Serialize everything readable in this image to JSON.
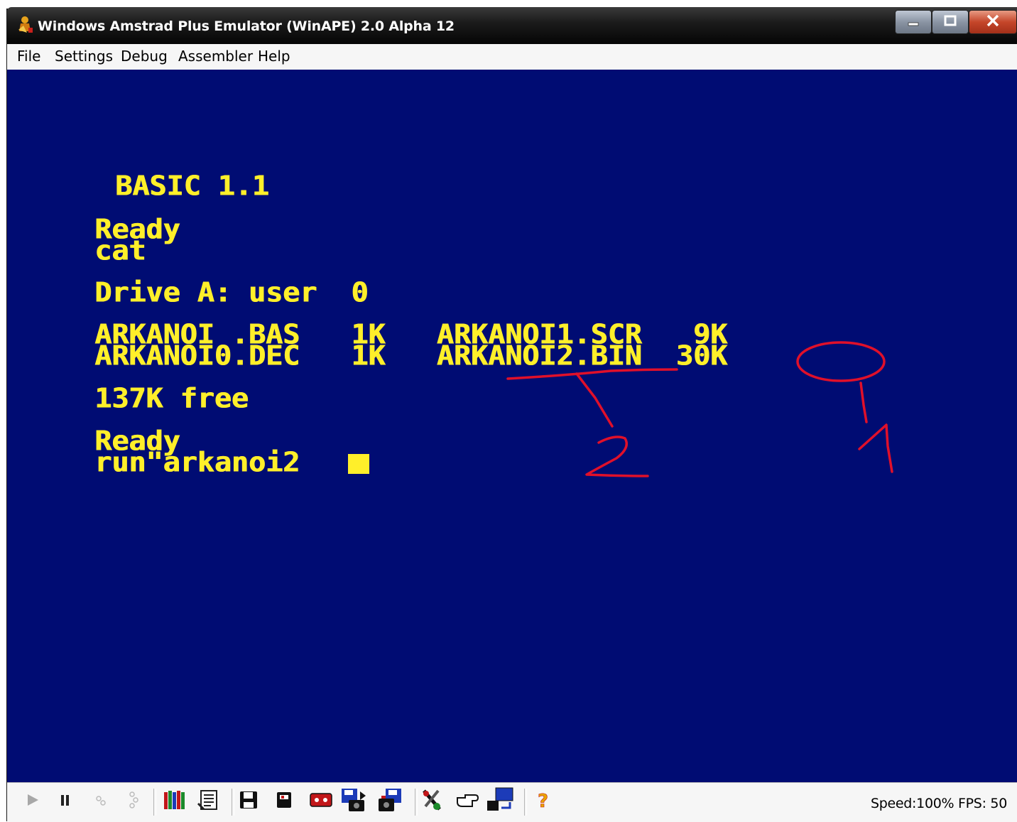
{
  "window": {
    "title": "Windows Amstrad Plus Emulator (WinAPE) 2.0 Alpha 12",
    "minimize_label": "–",
    "maximize_label": "□",
    "close_label": "X"
  },
  "menu": [
    "File",
    "Settings",
    "Debug",
    "Assembler",
    "Help"
  ],
  "screen": {
    "colors": {
      "background": "#000c73",
      "text": "#ffef2a",
      "annotation": "#e0102a"
    },
    "lines": {
      "banner": "BASIC 1.1",
      "ready1": "Ready",
      "cmd_cat": "cat",
      "drive": "Drive A: user  0",
      "dir_row1": "ARKANOI .BAS   1K   ARKANOI1.SCR   9K",
      "dir_row2": "ARKANOI0.DEC   1K   ARKANOI2.BIN  30K",
      "free": "137K free",
      "ready2": "Ready",
      "cmd_run": "run\"arkanoi2"
    },
    "annotation_labels": {
      "mark_2": "2",
      "mark_1": "1"
    }
  },
  "toolbar": {
    "icons": [
      "play-icon",
      "pause-icon",
      "step-icon",
      "step-over-icon",
      "colour-palette-icon",
      "disassembly-icon",
      "save-disk-icon",
      "disk-drive-icon",
      "tape-icon",
      "snapshot-load-icon",
      "snapshot-save-icon",
      "tools-icon",
      "pointer-hand-icon",
      "network-transfer-icon",
      "help-icon"
    ],
    "status": "Speed:100%  FPS: 50"
  }
}
